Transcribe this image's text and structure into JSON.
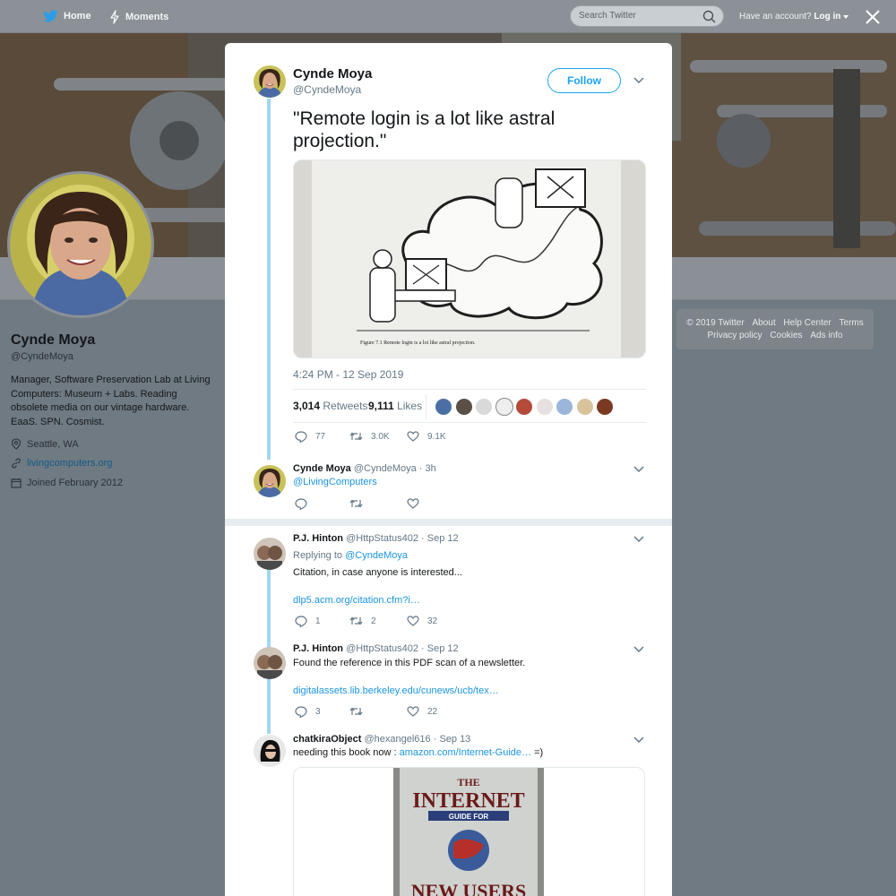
{
  "nav": {
    "home_label": "Home",
    "moments_label": "Moments",
    "search_placeholder": "Search Twitter",
    "have_account": "Have an account?",
    "login_label": "Log in"
  },
  "profile": {
    "name": "Cynde Moya",
    "handle": "@CyndeMoya",
    "bio": "Manager, Software Preservation Lab at Living Computers: Museum + Labs. Reading obsolete media on our vintage hardware. EaaS. SPN. Cosmist.",
    "location": "Seattle, WA",
    "website": "livingcomputers.org",
    "joined": "Joined February 2012"
  },
  "footer": {
    "copyright": "© 2019 Twitter",
    "about": "About",
    "help": "Help Center",
    "terms": "Terms",
    "privacy": "Privacy policy",
    "cookies": "Cookies",
    "ads": "Ads info"
  },
  "main_tweet": {
    "author_name": "Cynde Moya",
    "author_handle": "@CyndeMoya",
    "follow_label": "Follow",
    "text": "\"Remote login is a lot like astral projection.\"",
    "figure_caption": "Figure 7.1   Remote login is a lot like astral projection.",
    "timestamp": "4:24 PM - 12 Sep 2019",
    "retweets_count": "3,014",
    "retweets_label": "Retweets",
    "likes_count": "9,111",
    "likes_label": "Likes",
    "reply_count": "77",
    "retweet_count_short": "3.0K",
    "like_count_short": "9.1K"
  },
  "self_reply": {
    "author_name": "Cynde Moya",
    "author_handle": "@CyndeMoya",
    "time": "· 3h",
    "text": "@LivingComputers"
  },
  "replies": [
    {
      "author_name": "P.J. Hinton",
      "author_handle": "@HttpStatus402",
      "time": "· Sep 12",
      "replying_to_label": "Replying to",
      "replying_to": "@CyndeMoya",
      "text": "Citation, in case anyone is interested...",
      "link": "dlp5.acm.org/citation.cfm?i…",
      "reply_count": "1",
      "retweet_count": "2",
      "like_count": "32"
    },
    {
      "author_name": "P.J. Hinton",
      "author_handle": "@HttpStatus402",
      "time": "· Sep 12",
      "text": "Found the reference in this PDF scan of a newsletter.",
      "link": "digitalassets.lib.berkeley.edu/cunews/ucb/tex…",
      "reply_count": "3",
      "like_count": "22"
    },
    {
      "author_name": "chatkiraObject",
      "author_handle": "@hexangel616",
      "time": "· Sep 13",
      "text_prefix": "needing this book now :",
      "link": "amazon.com/Internet-Guide…",
      "text_suffix": "=)",
      "book_title_1": "THE",
      "book_title_2": "INTERNET",
      "book_title_3": "GUIDE FOR",
      "book_title_4": "NEW USERS"
    }
  ],
  "colors": {
    "accent": "#1da1f2",
    "link": "#1b95e0",
    "thread_line": "#a2d6f4",
    "muted": "#657786"
  }
}
